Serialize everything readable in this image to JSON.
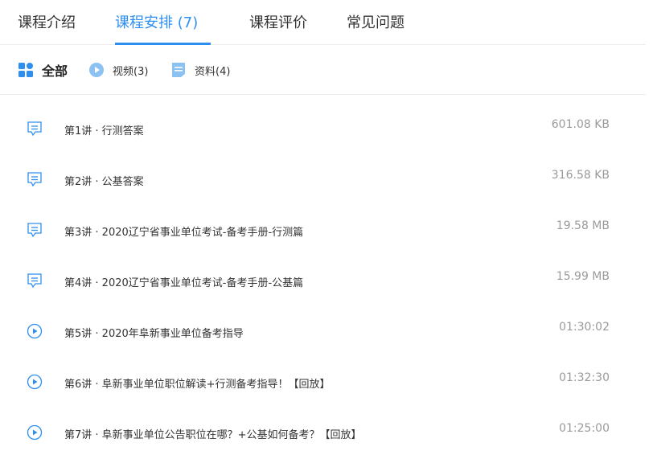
{
  "tabs": [
    {
      "label": "课程介绍",
      "active": false
    },
    {
      "label": "课程安排 (7)",
      "active": true
    },
    {
      "label": "课程评价",
      "active": false
    },
    {
      "label": "常见问题",
      "active": false
    }
  ],
  "filters": {
    "all": {
      "label": "全部",
      "icon": "grid-icon"
    },
    "video": {
      "label": "视频(3)",
      "icon": "play-circle-icon"
    },
    "docs": {
      "label": "资料(4)",
      "icon": "document-icon"
    }
  },
  "colors": {
    "accent": "#2f8ff0",
    "icon_light": "#8cc2f2",
    "meta": "#9a9a9a"
  },
  "lessons": [
    {
      "title": "第1讲 · 行测答案",
      "meta": "601.08 KB",
      "icon": "document-icon"
    },
    {
      "title": "第2讲 · 公基答案",
      "meta": "316.58 KB",
      "icon": "document-icon"
    },
    {
      "title": "第3讲 · 2020辽宁省事业单位考试-备考手册-行测篇",
      "meta": "19.58 MB",
      "icon": "document-icon"
    },
    {
      "title": "第4讲 · 2020辽宁省事业单位考试-备考手册-公基篇",
      "meta": "15.99 MB",
      "icon": "document-icon"
    },
    {
      "title": "第5讲 · 2020年阜新事业单位备考指导",
      "meta": "01:30:02",
      "icon": "play-circle-icon"
    },
    {
      "title": "第6讲 · 阜新事业单位职位解读+行测备考指导！【回放】",
      "meta": "01:32:30",
      "icon": "play-circle-icon"
    },
    {
      "title": "第7讲 · 阜新事业单位公告职位在哪？+公基如何备考？【回放】",
      "meta": "01:25:00",
      "icon": "play-circle-icon"
    }
  ]
}
